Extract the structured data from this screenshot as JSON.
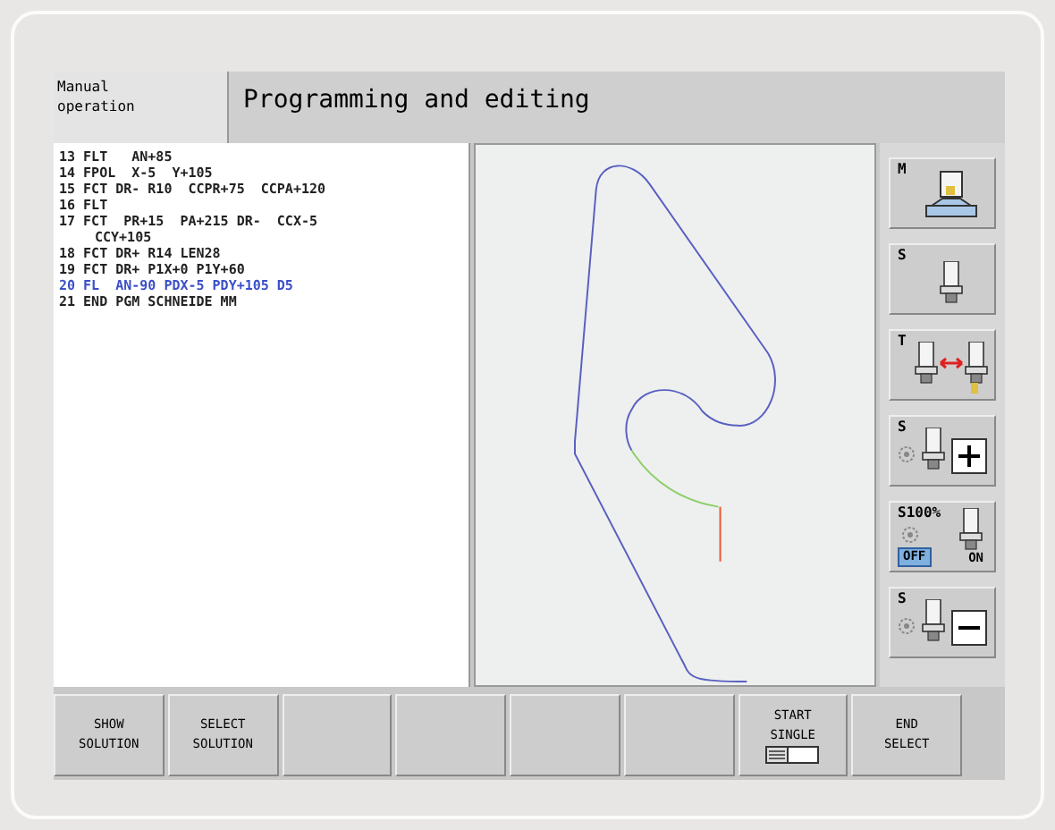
{
  "header": {
    "mode": "Manual\noperation",
    "title": "Programming and editing"
  },
  "program": [
    {
      "text": "13 FLT   AN+85",
      "selected": false
    },
    {
      "text": "14 FPOL  X-5  Y+105",
      "selected": false
    },
    {
      "text": "15 FCT DR- R10  CCPR+75  CCPA+120",
      "selected": false
    },
    {
      "text": "16 FLT",
      "selected": false
    },
    {
      "text": "17 FCT  PR+15  PA+215 DR-  CCX-5",
      "continuation": "CCY+105",
      "selected": false
    },
    {
      "text": "18 FCT DR+ R14 LEN28",
      "selected": false
    },
    {
      "text": "19 FCT DR+ P1X+0 P1Y+60",
      "selected": false
    },
    {
      "text": "20 FL  AN-90 PDX-5 PDY+105 D5",
      "selected": true
    },
    {
      "text": "21 END PGM SCHNEIDE MM",
      "selected": false
    }
  ],
  "side_keys": [
    {
      "kind": "machine",
      "label": "M"
    },
    {
      "kind": "spindle",
      "label": "S"
    },
    {
      "kind": "tool-change",
      "label": "T"
    },
    {
      "kind": "plus",
      "label": "S"
    },
    {
      "kind": "override",
      "label": "S100%",
      "toggle": [
        {
          "label": "OFF",
          "selected": true
        },
        {
          "label": "ON",
          "selected": false
        }
      ]
    },
    {
      "kind": "minus",
      "label": "S"
    }
  ],
  "soft_keys": [
    {
      "kind": "text",
      "lines": [
        "SHOW",
        "SOLUTION"
      ]
    },
    {
      "kind": "text",
      "lines": [
        "SELECT",
        "SOLUTION"
      ]
    },
    {
      "kind": "blank"
    },
    {
      "kind": "blank"
    },
    {
      "kind": "blank"
    },
    {
      "kind": "blank"
    },
    {
      "kind": "single",
      "lines": [
        "START",
        "SINGLE"
      ]
    },
    {
      "kind": "text",
      "lines": [
        "END",
        "SELECT"
      ]
    }
  ]
}
